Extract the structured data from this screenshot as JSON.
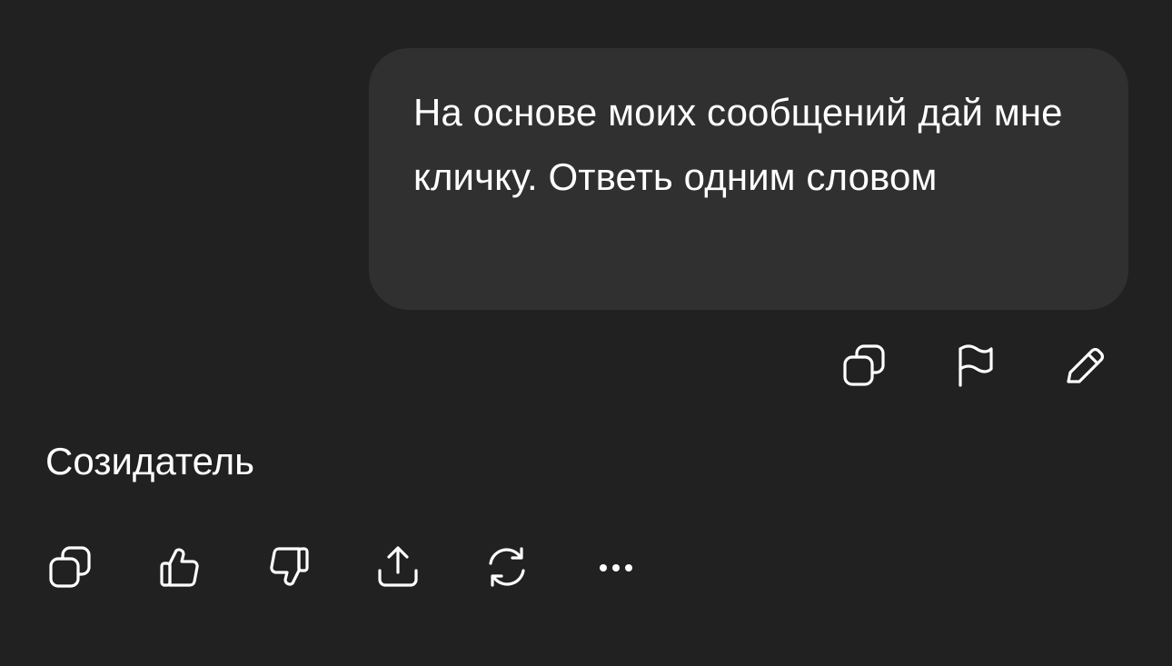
{
  "conversation": {
    "user_message": {
      "text": "На основе моих сообщений дай мне кличку. Ответь одним словом",
      "actions": [
        {
          "name": "copy",
          "icon": "copy-icon"
        },
        {
          "name": "report",
          "icon": "flag-icon"
        },
        {
          "name": "edit",
          "icon": "pencil-icon"
        }
      ]
    },
    "assistant_message": {
      "text": "Созидатель",
      "actions": [
        {
          "name": "copy",
          "icon": "copy-icon"
        },
        {
          "name": "like",
          "icon": "thumbs-up-icon"
        },
        {
          "name": "dislike",
          "icon": "thumbs-down-icon"
        },
        {
          "name": "share",
          "icon": "share-icon"
        },
        {
          "name": "regenerate",
          "icon": "refresh-icon"
        },
        {
          "name": "more",
          "icon": "more-icon"
        }
      ]
    }
  },
  "colors": {
    "background": "#212121",
    "user_bubble": "#303030",
    "text": "#ffffff"
  }
}
